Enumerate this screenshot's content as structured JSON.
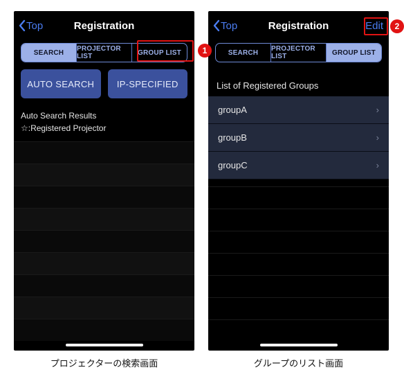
{
  "colors": {
    "accent": "#4b7df2",
    "segFill": "#9cb0e8",
    "btn": "#3b519d",
    "callout": "#e11313"
  },
  "left": {
    "nav": {
      "back": "Top",
      "title": "Registration"
    },
    "tabs": {
      "search": "SEARCH",
      "projector": "PROJECTOR LIST",
      "group": "GROUP LIST",
      "active": "search"
    },
    "buttons": {
      "auto_search": "AUTO SEARCH",
      "ip_specified": "IP-SPECIFIED"
    },
    "info": {
      "line1": "Auto Search Results",
      "line2": "☆:Registered Projector"
    },
    "caption": "プロジェクターの検索画面"
  },
  "right": {
    "nav": {
      "back": "Top",
      "title": "Registration",
      "edit": "Edit"
    },
    "tabs": {
      "search": "SEARCH",
      "projector": "PROJECTOR LIST",
      "group": "GROUP LIST",
      "active": "group"
    },
    "section_header": "List of Registered Groups",
    "groups": [
      {
        "name": "groupA"
      },
      {
        "name": "groupB"
      },
      {
        "name": "groupC"
      }
    ],
    "caption": "グループのリスト画面"
  },
  "badges": {
    "one": "1",
    "two": "2"
  }
}
